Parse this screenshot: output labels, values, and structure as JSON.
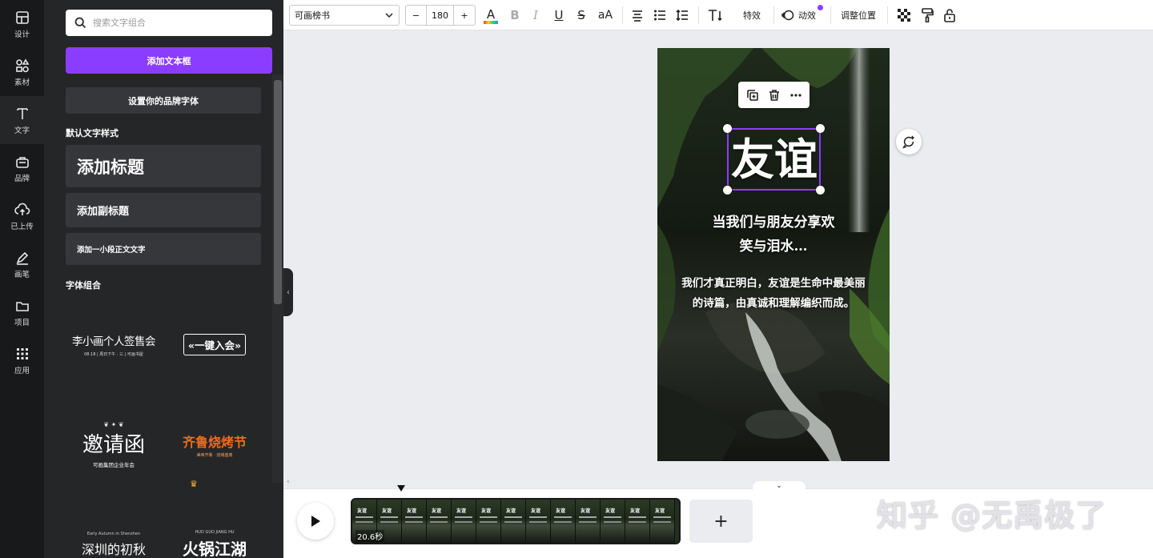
{
  "rail": [
    {
      "label": "设计",
      "icon": "layout-icon"
    },
    {
      "label": "素材",
      "icon": "elements-icon"
    },
    {
      "label": "文字",
      "icon": "text-icon"
    },
    {
      "label": "品牌",
      "icon": "brand-icon"
    },
    {
      "label": "已上传",
      "icon": "upload-icon"
    },
    {
      "label": "画笔",
      "icon": "draw-icon"
    },
    {
      "label": "项目",
      "icon": "folder-icon"
    },
    {
      "label": "应用",
      "icon": "apps-icon"
    }
  ],
  "panel": {
    "search_placeholder": "搜索文字组合",
    "add_textbox": "添加文本框",
    "brand_font": "设置你的品牌字体",
    "default_styles_title": "默认文字样式",
    "add_heading": "添加标题",
    "add_subheading": "添加副标题",
    "add_body": "添加一小段正文文字",
    "combos_title": "字体组合",
    "combos": [
      {
        "main": "李小画个人签售会",
        "sub": "08.18 | 周日下午 · 三 | 可画书屋",
        "premium": false
      },
      {
        "main": "«一键入会»",
        "sub": "",
        "premium": false
      },
      {
        "main": "邀请函",
        "sub": "可画集团企业年会",
        "premium": true
      },
      {
        "main": "齐鲁烧烤节",
        "sub": "美味齐鲁 · 烧烤盛典",
        "premium": true
      },
      {
        "main": "深圳的初秋",
        "sub": "Early Autumn in Shenzhen",
        "premium": false
      },
      {
        "main": "火锅江湖",
        "sub": "HUO GUO JIANG HU",
        "premium": false
      }
    ]
  },
  "toolbar": {
    "font": "可画榜书",
    "size": "180",
    "minus": "−",
    "plus": "+",
    "text_color_glyph": "A",
    "bold": "B",
    "italic": "I",
    "underline": "U",
    "strike": "S",
    "case": "aA",
    "effects": "特效",
    "animate": "动效",
    "position": "调整位置"
  },
  "design": {
    "headline": "友谊",
    "sub_line1": "当我们与朋友分享欢",
    "sub_line2": "笑与泪水…",
    "body_line1": "我们才真正明白，友谊是生命中最美丽",
    "body_line2": "的诗篇，由真诚和理解编织而成。"
  },
  "timeline": {
    "duration": "20.6秒",
    "frame_label": "友谊",
    "frames": 13,
    "add_page": "+"
  },
  "watermark": "知乎 @无禹极了",
  "colors": {
    "accent": "#8b3dff",
    "rail_bg": "#18191b",
    "panel_bg": "#252627",
    "canvas_bg": "#ebecf0"
  }
}
